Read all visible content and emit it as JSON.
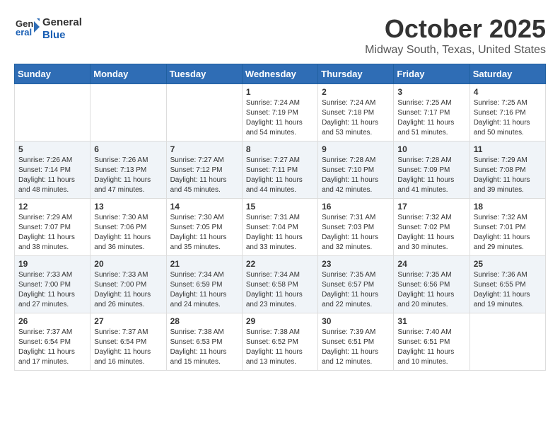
{
  "header": {
    "logo_general": "General",
    "logo_blue": "Blue",
    "title": "October 2025",
    "subtitle": "Midway South, Texas, United States"
  },
  "columns": [
    "Sunday",
    "Monday",
    "Tuesday",
    "Wednesday",
    "Thursday",
    "Friday",
    "Saturday"
  ],
  "weeks": [
    [
      {
        "day": "",
        "info": ""
      },
      {
        "day": "",
        "info": ""
      },
      {
        "day": "",
        "info": ""
      },
      {
        "day": "1",
        "info": "Sunrise: 7:24 AM\nSunset: 7:19 PM\nDaylight: 11 hours and 54 minutes."
      },
      {
        "day": "2",
        "info": "Sunrise: 7:24 AM\nSunset: 7:18 PM\nDaylight: 11 hours and 53 minutes."
      },
      {
        "day": "3",
        "info": "Sunrise: 7:25 AM\nSunset: 7:17 PM\nDaylight: 11 hours and 51 minutes."
      },
      {
        "day": "4",
        "info": "Sunrise: 7:25 AM\nSunset: 7:16 PM\nDaylight: 11 hours and 50 minutes."
      }
    ],
    [
      {
        "day": "5",
        "info": "Sunrise: 7:26 AM\nSunset: 7:14 PM\nDaylight: 11 hours and 48 minutes."
      },
      {
        "day": "6",
        "info": "Sunrise: 7:26 AM\nSunset: 7:13 PM\nDaylight: 11 hours and 47 minutes."
      },
      {
        "day": "7",
        "info": "Sunrise: 7:27 AM\nSunset: 7:12 PM\nDaylight: 11 hours and 45 minutes."
      },
      {
        "day": "8",
        "info": "Sunrise: 7:27 AM\nSunset: 7:11 PM\nDaylight: 11 hours and 44 minutes."
      },
      {
        "day": "9",
        "info": "Sunrise: 7:28 AM\nSunset: 7:10 PM\nDaylight: 11 hours and 42 minutes."
      },
      {
        "day": "10",
        "info": "Sunrise: 7:28 AM\nSunset: 7:09 PM\nDaylight: 11 hours and 41 minutes."
      },
      {
        "day": "11",
        "info": "Sunrise: 7:29 AM\nSunset: 7:08 PM\nDaylight: 11 hours and 39 minutes."
      }
    ],
    [
      {
        "day": "12",
        "info": "Sunrise: 7:29 AM\nSunset: 7:07 PM\nDaylight: 11 hours and 38 minutes."
      },
      {
        "day": "13",
        "info": "Sunrise: 7:30 AM\nSunset: 7:06 PM\nDaylight: 11 hours and 36 minutes."
      },
      {
        "day": "14",
        "info": "Sunrise: 7:30 AM\nSunset: 7:05 PM\nDaylight: 11 hours and 35 minutes."
      },
      {
        "day": "15",
        "info": "Sunrise: 7:31 AM\nSunset: 7:04 PM\nDaylight: 11 hours and 33 minutes."
      },
      {
        "day": "16",
        "info": "Sunrise: 7:31 AM\nSunset: 7:03 PM\nDaylight: 11 hours and 32 minutes."
      },
      {
        "day": "17",
        "info": "Sunrise: 7:32 AM\nSunset: 7:02 PM\nDaylight: 11 hours and 30 minutes."
      },
      {
        "day": "18",
        "info": "Sunrise: 7:32 AM\nSunset: 7:01 PM\nDaylight: 11 hours and 29 minutes."
      }
    ],
    [
      {
        "day": "19",
        "info": "Sunrise: 7:33 AM\nSunset: 7:00 PM\nDaylight: 11 hours and 27 minutes."
      },
      {
        "day": "20",
        "info": "Sunrise: 7:33 AM\nSunset: 7:00 PM\nDaylight: 11 hours and 26 minutes."
      },
      {
        "day": "21",
        "info": "Sunrise: 7:34 AM\nSunset: 6:59 PM\nDaylight: 11 hours and 24 minutes."
      },
      {
        "day": "22",
        "info": "Sunrise: 7:34 AM\nSunset: 6:58 PM\nDaylight: 11 hours and 23 minutes."
      },
      {
        "day": "23",
        "info": "Sunrise: 7:35 AM\nSunset: 6:57 PM\nDaylight: 11 hours and 22 minutes."
      },
      {
        "day": "24",
        "info": "Sunrise: 7:35 AM\nSunset: 6:56 PM\nDaylight: 11 hours and 20 minutes."
      },
      {
        "day": "25",
        "info": "Sunrise: 7:36 AM\nSunset: 6:55 PM\nDaylight: 11 hours and 19 minutes."
      }
    ],
    [
      {
        "day": "26",
        "info": "Sunrise: 7:37 AM\nSunset: 6:54 PM\nDaylight: 11 hours and 17 minutes."
      },
      {
        "day": "27",
        "info": "Sunrise: 7:37 AM\nSunset: 6:54 PM\nDaylight: 11 hours and 16 minutes."
      },
      {
        "day": "28",
        "info": "Sunrise: 7:38 AM\nSunset: 6:53 PM\nDaylight: 11 hours and 15 minutes."
      },
      {
        "day": "29",
        "info": "Sunrise: 7:38 AM\nSunset: 6:52 PM\nDaylight: 11 hours and 13 minutes."
      },
      {
        "day": "30",
        "info": "Sunrise: 7:39 AM\nSunset: 6:51 PM\nDaylight: 11 hours and 12 minutes."
      },
      {
        "day": "31",
        "info": "Sunrise: 7:40 AM\nSunset: 6:51 PM\nDaylight: 11 hours and 10 minutes."
      },
      {
        "day": "",
        "info": ""
      }
    ]
  ]
}
